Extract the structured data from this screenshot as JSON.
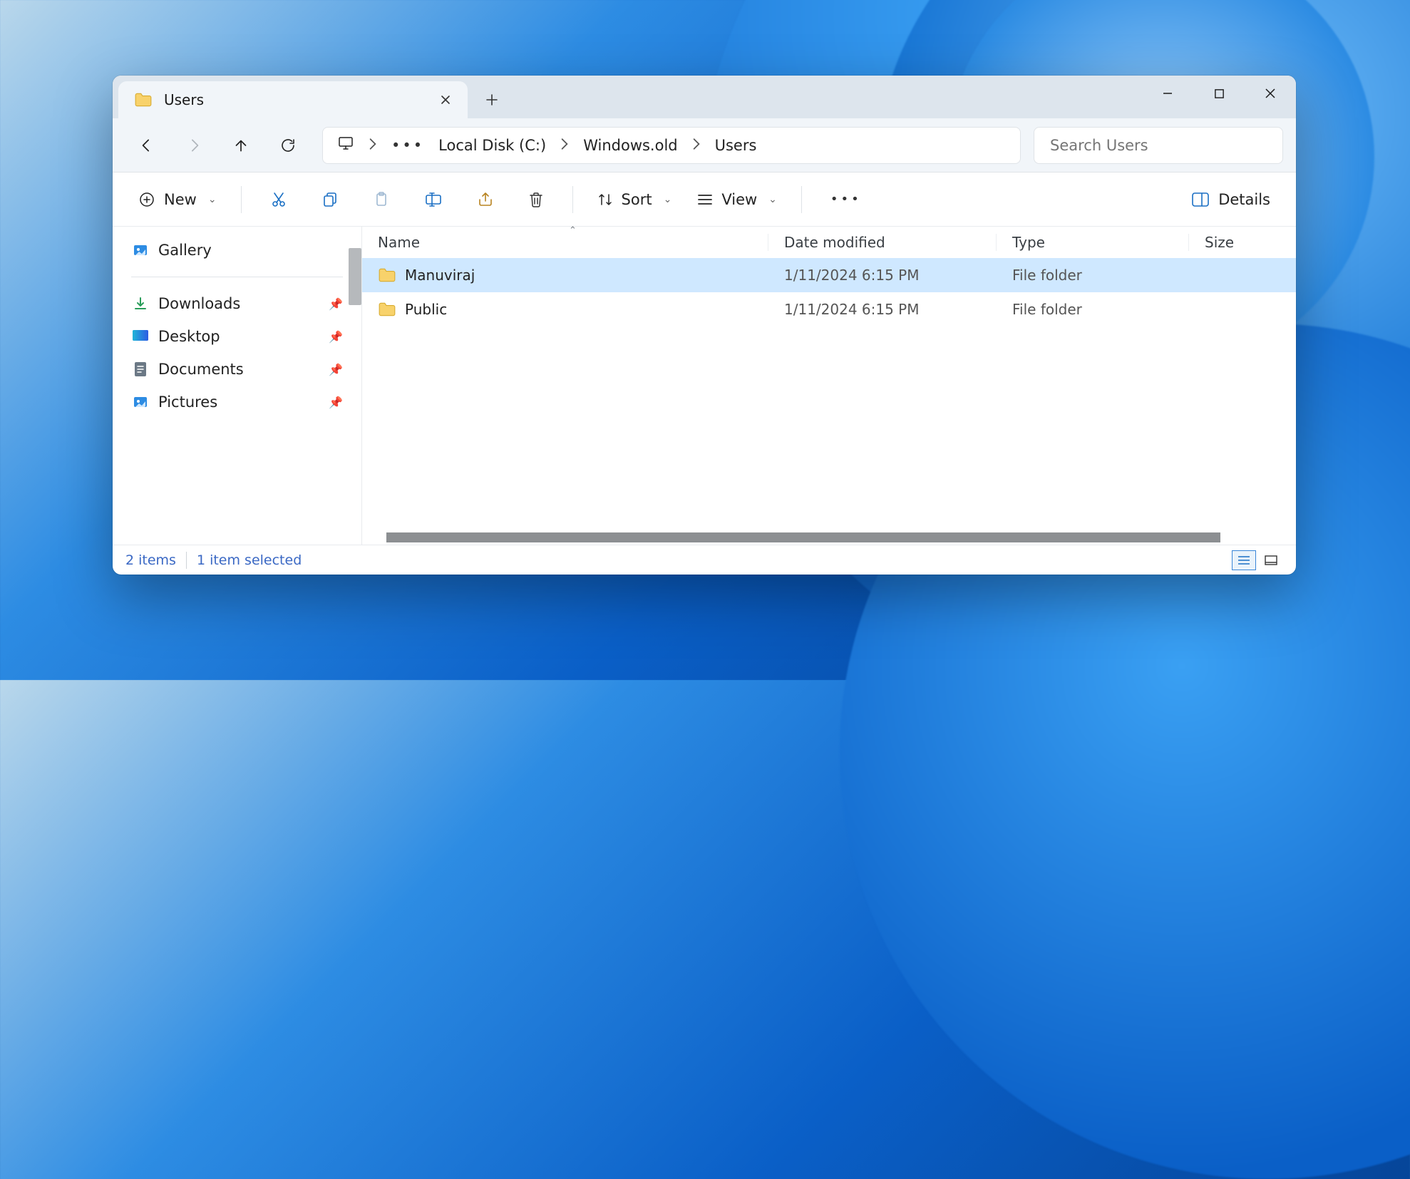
{
  "tab": {
    "title": "Users"
  },
  "breadcrumb": {
    "root": "Local Disk (C:)",
    "parts": [
      "Windows.old",
      "Users"
    ]
  },
  "search": {
    "placeholder": "Search Users"
  },
  "toolbar": {
    "new": "New",
    "sort": "Sort",
    "view": "View",
    "details": "Details"
  },
  "sidebar": {
    "gallery": "Gallery",
    "items": [
      {
        "label": "Downloads"
      },
      {
        "label": "Desktop"
      },
      {
        "label": "Documents"
      },
      {
        "label": "Pictures"
      }
    ]
  },
  "columns": {
    "name": "Name",
    "date": "Date modified",
    "type": "Type",
    "size": "Size"
  },
  "rows": [
    {
      "name": "Manuviraj",
      "date": "1/11/2024 6:15 PM",
      "type": "File folder",
      "selected": true
    },
    {
      "name": "Public",
      "date": "1/11/2024 6:15 PM",
      "type": "File folder",
      "selected": false
    }
  ],
  "status": {
    "count": "2 items",
    "selection": "1 item selected"
  }
}
